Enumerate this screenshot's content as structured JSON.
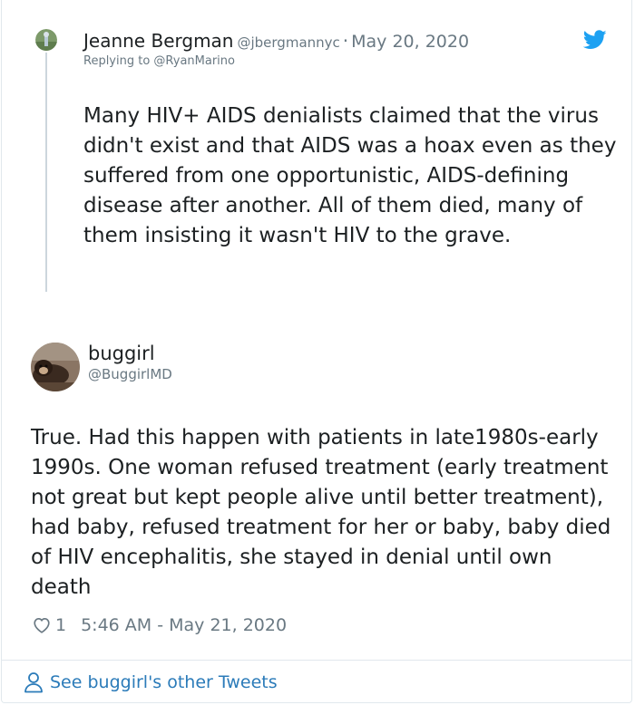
{
  "parent_tweet": {
    "avatar": "profile-photo-icon",
    "name": "Jeanne Bergman",
    "handle": "@jbergmannyc",
    "separator": "·",
    "date": "May 20, 2020",
    "replying_to": "Replying to @RyanMarino",
    "text": "Many HIV+ AIDS denialists claimed that the virus didn't exist and that AIDS was a hoax even as they suffered from one opportunistic, AIDS-defining disease after another. All of them died, many of them insisting it wasn't HIV to the grave."
  },
  "tweet": {
    "avatar": "profile-photo-icon",
    "name": "buggirl",
    "handle": "@BuggirlMD",
    "text": "True. Had this happen with patients in late1980s-early 1990s. One woman refused treatment (early treatment not great but kept people alive until better treatment), had baby, refused treatment for her or baby, baby died of HIV encephalitis, she stayed in denial until own death",
    "likes": "1",
    "timestamp": "5:46 AM - May 21, 2020"
  },
  "footer": {
    "see_other_label": "See buggirl's other Tweets",
    "icon": "person-icon"
  },
  "colors": {
    "twitter_blue": "#1da1f2",
    "link_blue": "#2b7bb9",
    "secondary_text": "#697882",
    "primary_text": "#1c2022",
    "border": "#e1e8ed"
  }
}
